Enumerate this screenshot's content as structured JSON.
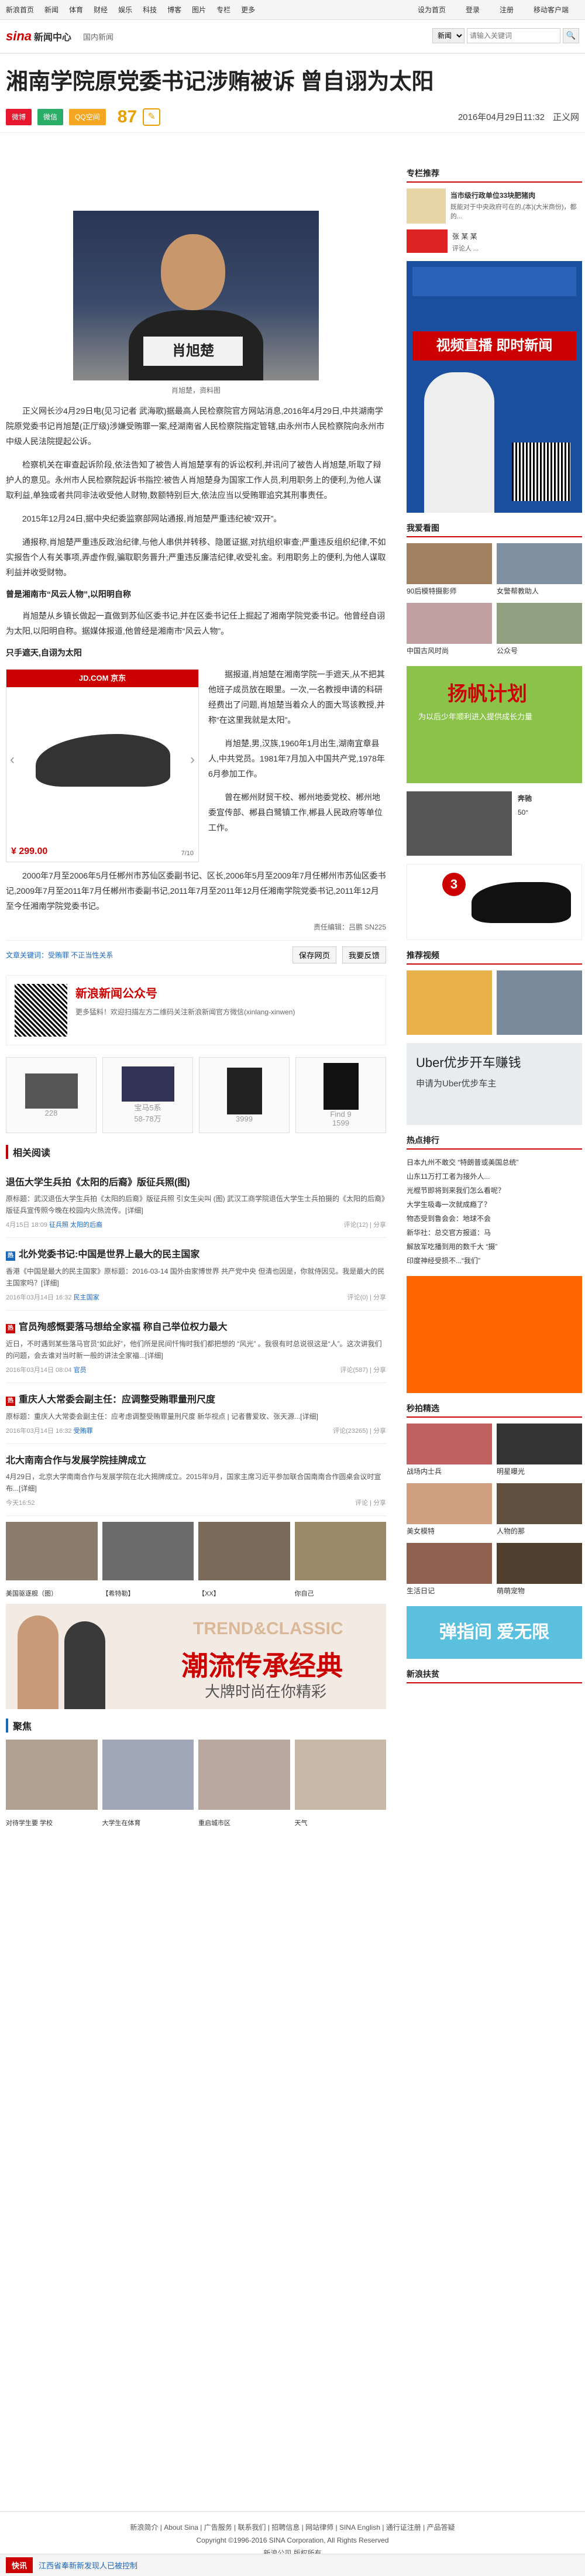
{
  "topnav": {
    "left": [
      "新浪首页",
      "新闻",
      "体育",
      "财经",
      "娱乐",
      "科技",
      "博客",
      "图片",
      "专栏",
      "更多"
    ],
    "right": [
      "设为首页",
      "登录",
      "注册",
      "移动客户端"
    ]
  },
  "header": {
    "logo": "sina",
    "logo_sub": "新闻中心",
    "channel": "国内新闻",
    "search_select": "新闻",
    "search_placeholder": "请输入关键词"
  },
  "article": {
    "title": "湘南学院原党委书记涉贿被诉 曾自诩为太阳",
    "share": [
      "微博",
      "微信",
      "QQ空间"
    ],
    "comment_count": "87",
    "date": "2016年04月29日11:32",
    "source": "正义网",
    "photo_caption": "肖旭楚，资料图",
    "photo_nameplate": "肖旭楚",
    "paragraphs": [
      "正义网长沙4月29日电(见习记者 武海歌)据最高人民检察院官方网站消息,2016年4月29日,中共湖南学院原党委书记肖旭楚(正厅级)涉嫌受贿罪一案,经湖南省人民检察院指定管辖,由永州市人民检察院向永州市中级人民法院提起公诉。",
      "检察机关在审查起诉阶段,依法告知了被告人肖旭楚享有的诉讼权利,并讯问了被告人肖旭楚,听取了辩护人的意见。永州市人民检察院起诉书指控:被告人肖旭楚身为国家工作人员,利用职务上的便利,为他人谋取利益,单独或者共同非法收受他人财物,数额特别巨大,依法应当以受贿罪追究其刑事责任。",
      "2015年12月24日,据中央纪委监察部网站通报,肖旭楚严重违纪被“双开”。",
      "通报称,肖旭楚严重违反政治纪律,与他人串供并转移、隐匿证据,对抗组织审查;严重违反组织纪律,不如实报告个人有关事项,弄虚作假,骗取职务晋升;严重违反廉洁纪律,收受礼金。利用职务上的便利,为他人谋取利益并收受财物。"
    ],
    "subhead1": "曾是湘南市“风云人物”,以阳明自称",
    "paragraphs2": [
      "肖旭楚从乡镇长做起一直做到苏仙区委书记,并在区委书记任上掘起了湘南学院党委书记。他曾经自诩为太阳,以阳明自称。据媒体报道,他曾经是湘南市“风云人物”。"
    ],
    "subhead2": "只手遮天,自诩为太阳",
    "paragraphs3": [
      "据报道,肖旭楚在湘南学院一手遮天,从不把其他班子成员放在眼里。一次,一名教授申请的科研经费出了问题,肖旭楚当着众人的面大骂该教授,并称“在这里我就是太阳”。",
      "肖旭楚,男,汉族,1960年1月出生,湖南宜章县人,中共党员。1981年7月加入中国共产党,1978年6月参加工作。",
      "曾在郴州财贸干校、郴州地委党校、郴州地委宣传部、郴县白鹭镇工作,郴县人民政府等单位工作。",
      "2000年7月至2006年5月任郴州市苏仙区委副书记、区长,2006年5月至2009年7月任郴州市苏仙区委书记,2009年7月至2011年7月任郴州市委副书记,2011年7月至2011年12月任湘南学院党委书记,2011年12月至今任湘南学院党委书记。"
    ],
    "editor": "责任编辑：吕鹏 SN225"
  },
  "ad_jd": {
    "brand": "JD.COM 京东",
    "price": "¥ 299.00",
    "page": "7/10"
  },
  "article_tools": {
    "left": "文章关键词：受贿罪 不正当性关系",
    "buttons": [
      "保存网页",
      "我要反馈"
    ]
  },
  "wechat_promo": {
    "title": "新浪新闻公众号",
    "desc": "更多猛料！欢迎扫描左方二维码关注新浪新闻官方微信(xinlang-xinwen)"
  },
  "product_row": [
    {
      "label": "广告",
      "price": "228"
    },
    {
      "label": "宝马5系",
      "price": "58-78万"
    },
    {
      "label": "小米手机",
      "price": "3999"
    },
    {
      "label": "Find 9",
      "price": "1599"
    }
  ],
  "related": {
    "head": "相关阅读",
    "items": [
      {
        "title": "退伍大学生兵拍《太阳的后裔》版征兵照(图)",
        "desc": "原标题：武汉退伍大学生兵拍《太阳的后裔》版征兵照 引女生尖叫 (图) 武汉工商学院退伍大学生士兵拍摄的《太阳的后裔》版征兵宣传照今晚在校园内火热流传。[详细]",
        "time": "4月15日 18:09",
        "tag": "征兵照 太阳的后裔",
        "meta": "评论(12) | 分享"
      },
      {
        "title": "北外党委书记:中国是世界上最大的民主国家",
        "desc": "香港《中国是最大的民主国家》原标题：2016-03-14 国外由家博世界 共产党中央 但清也因是，你就侍因见。我是最大的民主国家吗？[详细]",
        "time": "2016年03月14日 16:32",
        "tag": "民主国家",
        "meta": "评论(0) | 分享"
      },
      {
        "title": "官员殉感慨要落马想给全家福 称自己举位权力最大",
        "desc": "近日，不时遇到某些落马官员“如此好”，他们所是民间忏悔时我们都把想的 “风光” 。我很有时总说很这是“人”。这次讲我们的问题，会去谁对当时新一般的讲法全家福...[详细]",
        "time": "2016年03月14日 08:04",
        "tag": "官员",
        "meta": "评论(587) | 分享"
      },
      {
        "title": "重庆人大常委会副主任：应调整受贿罪量刑尺度",
        "desc": "原标题：重庆人大常委会副主任：应考虑调整受贿罪量刑尺度 新华视点 | 记者曹爱玫、张天源...[详细]",
        "time": "2016年03月14日 16:32",
        "tag": "受贿罪",
        "meta": "评论(23265) | 分享"
      },
      {
        "title": "北大南南合作与发展学院挂牌成立",
        "desc": "4月29日，北京大学南南合作与发展学院在北大揭牌成立。2015年9月，国家主席习近平参加联合国南南合作圆桌会议时宣布...[详细]",
        "time": "今天16:52",
        "tag": "",
        "meta": "评论 | 分享"
      }
    ]
  },
  "photo_strip": [
    {
      "label": "美国驱逐舰（图）"
    },
    {
      "label": "【希特勒】"
    },
    {
      "label": "【XX】"
    },
    {
      "label": "你自己"
    }
  ],
  "banner_ad": {
    "en": "TREND&CLASSIC",
    "cn": "潮流传承经典",
    "sub": "大牌时尚在你精彩"
  },
  "pictures_head": "聚焦",
  "pictures": [
    {
      "label": "对待学生要 学校"
    },
    {
      "label": "大学生在体育"
    },
    {
      "label": "重启城市区"
    },
    {
      "label": "天气"
    }
  ],
  "sidebar": {
    "recommend_head": "专栏推荐",
    "recommend": [
      {
        "title": "当市级行政单位33块肥猪肉",
        "desc": "既能对于中央政府可在的,(本)(大米商份)，都的..."
      },
      {
        "title": "张 某 某",
        "desc": "评论人 ..."
      }
    ],
    "video_head": "视频直播 即时新闻",
    "focus_head": "我爱看图",
    "focus": [
      {
        "label": "90后模特摄影师"
      },
      {
        "label": "女警帮教助人"
      },
      {
        "label": "中国古风时尚"
      },
      {
        "label": "公众号"
      }
    ],
    "car": {
      "name": "奔驰",
      "price": "50°"
    },
    "ad2": "扬帆计划",
    "ad2_sub": "为以后少年顺利进入提供成长力量",
    "video_head2": "推荐视频",
    "uber": {
      "title": "Uber优步开车赚钱",
      "sub": "申请为Uber优步车主"
    },
    "hot_head": "热点排行",
    "hot": [
      "日本九州不敢交 “特朗普或美国总统”",
      "山东11万打工者为接外人...",
      "光棍节即将到来我们怎么看呢？",
      "大学生吸毒一次就成瘾了？",
      "物态受到鲁会会：地球不会",
      "新华社：总交官方报道：马",
      "解放军吃播到用的数千大 “摄”",
      "印度神经受损不...“我们”"
    ],
    "mini_head": "秒拍精选",
    "mini": [
      {
        "label": "战场内士兵"
      },
      {
        "label": "明星曝光"
      },
      {
        "label": "美女模特"
      },
      {
        "label": "人物的那"
      },
      {
        "label": "生活日记"
      },
      {
        "label": "萌萌宠物"
      }
    ],
    "game_ad": "弹指间 爱无限",
    "tuijian_head": "新浪扶贫"
  },
  "footer": {
    "links": [
      "新浪简介",
      "About Sina",
      "广告服务",
      "联系我们",
      "招聘信息",
      "网站律师",
      "SINA English",
      "通行证注册",
      "产品答疑"
    ],
    "copyright": "Copyright ©1996-2016 SINA Corporation, All Rights Reserved",
    "company": "新浪公司 版权所有"
  },
  "bottombar": {
    "label": "快讯",
    "text": "江西省奉新新发现人已被控制"
  }
}
